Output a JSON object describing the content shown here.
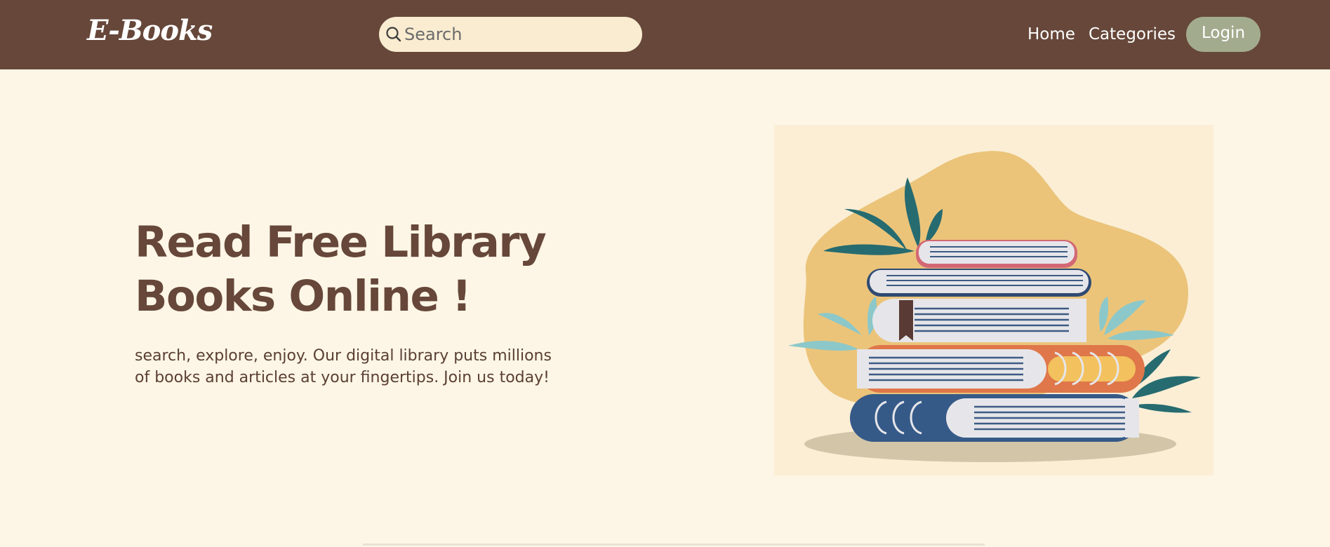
{
  "header": {
    "logo": "E-Books",
    "search": {
      "placeholder": "Search",
      "value": ""
    },
    "nav": {
      "home": "Home",
      "categories": "Categories"
    },
    "login_label": "Login"
  },
  "hero": {
    "title_line1": "Read Free Library",
    "title_line2": "Books Online !",
    "description_line1": "search, explore, enjoy. Our digital library puts millions",
    "description_line2": "of books and articles at your fingertips. Join us today!",
    "illustration": "stack-of-books-illustration"
  },
  "colors": {
    "navbar": "#664739",
    "page_background": "#fdf6e6",
    "search_background": "#f9ecd0",
    "login_button": "#a3ab8e",
    "heading": "#664739"
  }
}
